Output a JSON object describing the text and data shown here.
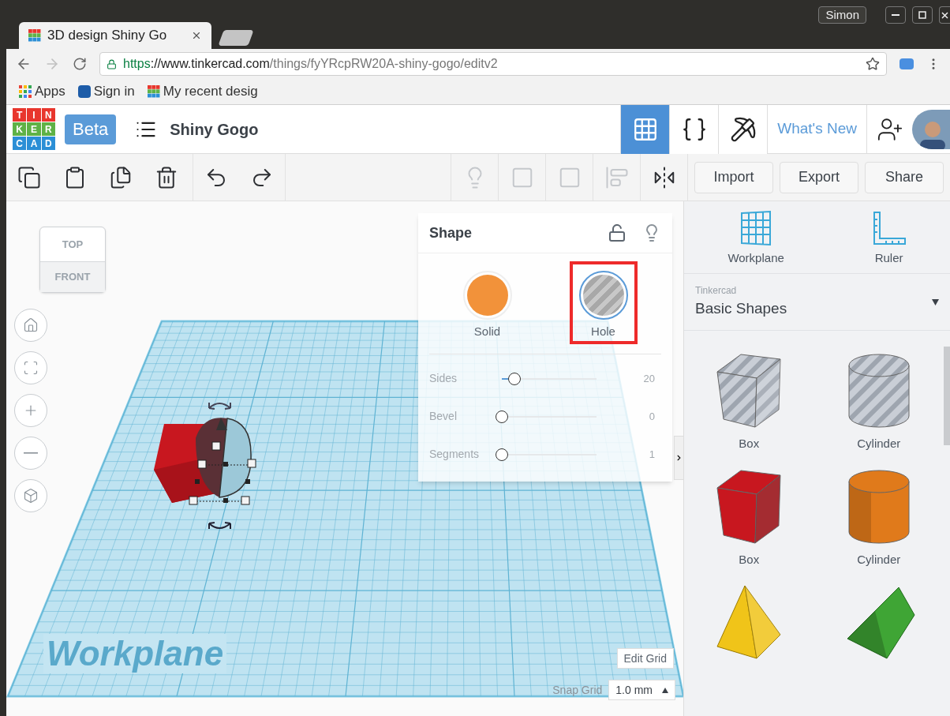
{
  "browser": {
    "tab": {
      "title": "3D design Shiny Go"
    },
    "profile": "Simon",
    "url": {
      "scheme": "https",
      "host": "://www.tinkercad.com",
      "path": "/things/fyYRcpRW20A-shiny-gogo/editv2"
    },
    "bookmarks": [
      {
        "label": "Apps",
        "kind": "apps"
      },
      {
        "label": "Sign in",
        "kind": "onshape"
      },
      {
        "label": "My recent desig",
        "kind": "tinkercad"
      }
    ]
  },
  "app": {
    "logo": [
      {
        "letter": "T",
        "color": "#e8362d"
      },
      {
        "letter": "I",
        "color": "#e8362d"
      },
      {
        "letter": "N",
        "color": "#e8362d"
      },
      {
        "letter": "K",
        "color": "#5fb246"
      },
      {
        "letter": "E",
        "color": "#5fb246"
      },
      {
        "letter": "R",
        "color": "#5fb246"
      },
      {
        "letter": "C",
        "color": "#2b8fd6"
      },
      {
        "letter": "A",
        "color": "#2b8fd6"
      },
      {
        "letter": "D",
        "color": "#2b8fd6"
      }
    ],
    "badge": "Beta",
    "design_name": "Shiny Gogo",
    "views": [
      {
        "kind": "grid",
        "selected": true
      },
      {
        "kind": "code",
        "selected": false
      },
      {
        "kind": "pickaxe",
        "selected": false
      }
    ],
    "whats_new": "What's New"
  },
  "toolbar": {
    "tools": [
      {
        "kind": "copy",
        "disabled": false
      },
      {
        "kind": "paste",
        "disabled": false
      },
      {
        "kind": "duplicate",
        "disabled": false
      },
      {
        "kind": "delete",
        "disabled": false
      },
      {
        "kind": "undo",
        "disabled": false
      },
      {
        "kind": "redo",
        "disabled": false
      },
      {
        "kind": "note",
        "disabled": true
      },
      {
        "kind": "group",
        "disabled": true
      },
      {
        "kind": "ungroup",
        "disabled": true
      },
      {
        "kind": "align",
        "disabled": true
      },
      {
        "kind": "mirror",
        "disabled": false
      }
    ],
    "buttons": [
      "Import",
      "Export",
      "Share"
    ]
  },
  "view_cube": {
    "top": "TOP",
    "front": "FRONT"
  },
  "nav_buttons": [
    {
      "kind": "home"
    },
    {
      "kind": "fit"
    },
    {
      "kind": "zoom-in"
    },
    {
      "kind": "zoom-out"
    },
    {
      "kind": "perspective"
    }
  ],
  "workplane_label": "Workplane",
  "inspector": {
    "title": "Shape",
    "locked": false,
    "types": [
      {
        "label": "Solid",
        "kind": "solid",
        "selected": false,
        "highlighted": false
      },
      {
        "label": "Hole",
        "kind": "hole",
        "selected": true,
        "highlighted": true
      }
    ],
    "params": [
      {
        "label": "Sides",
        "level": 0.13,
        "value": "20"
      },
      {
        "label": "Bevel",
        "level": 0,
        "value": "0"
      },
      {
        "label": "Segments",
        "level": 0,
        "value": "1"
      }
    ]
  },
  "panel": {
    "tools": [
      {
        "label": "Workplane",
        "kind": "workplane"
      },
      {
        "label": "Ruler",
        "kind": "ruler"
      }
    ],
    "library": {
      "source": "Tinkercad",
      "name": "Basic Shapes"
    },
    "shapes": [
      {
        "label": "Box",
        "kind": "box",
        "hole": true
      },
      {
        "label": "Cylinder",
        "kind": "cylinder",
        "hole": true
      },
      {
        "label": "Box",
        "kind": "box",
        "hole": false,
        "color": "#c8171f"
      },
      {
        "label": "Cylinder",
        "kind": "cylinder",
        "hole": false,
        "color": "#e07a1b"
      },
      {
        "kind": "pyramid",
        "hole": false,
        "color": "#f0c419"
      },
      {
        "kind": "roof",
        "hole": false,
        "color": "#3fa535"
      }
    ]
  },
  "grid": {
    "edit": "Edit Grid",
    "snap_label": "Snap Grid",
    "snap_value": "1.0 mm"
  }
}
